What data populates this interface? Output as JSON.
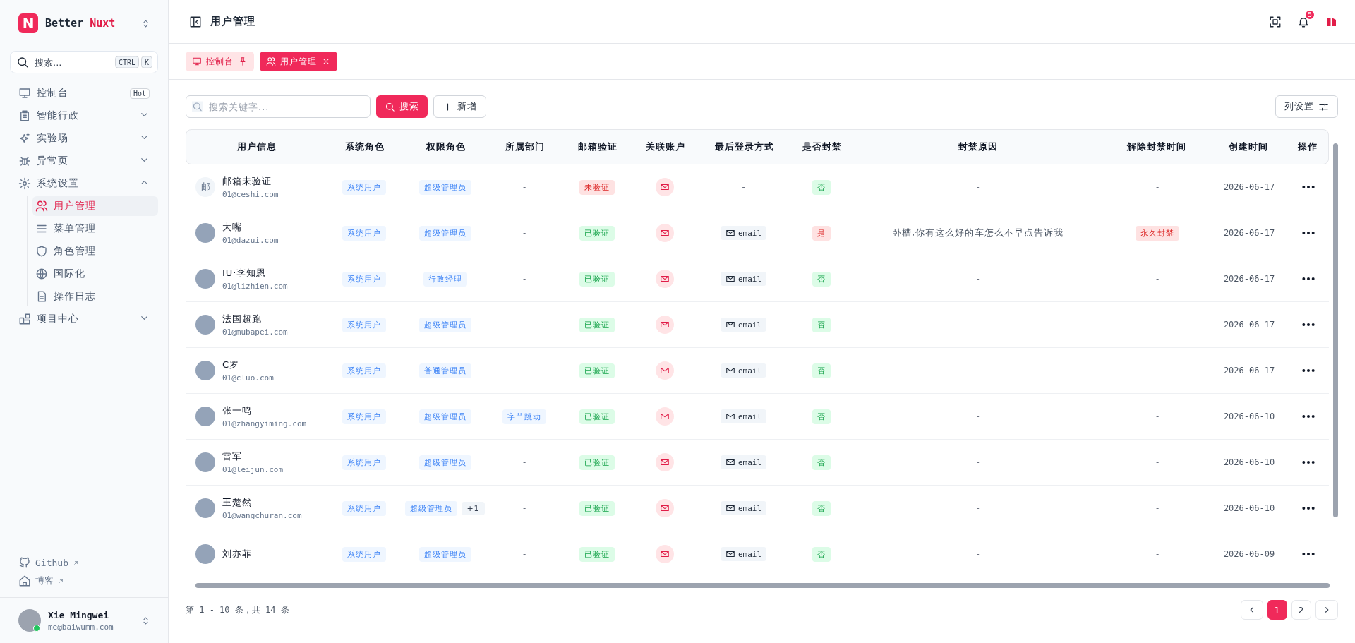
{
  "sidebar": {
    "brand": {
      "name": "Better",
      "accent": "Nuxt",
      "logo": "N"
    },
    "search": {
      "placeholder": "搜索...",
      "keys": [
        "CTRL",
        "K"
      ]
    },
    "menu": [
      {
        "label": "控制台",
        "badge": "Hot",
        "selected": false
      },
      {
        "label": "智能行政",
        "expanded": false,
        "selected": false
      },
      {
        "label": "实验场",
        "expanded": false,
        "selected": false
      },
      {
        "label": "异常页",
        "expanded": false,
        "selected": false
      },
      {
        "label": "系统设置",
        "expanded": true,
        "selected": false,
        "children": [
          {
            "label": "用户管理",
            "selected": true
          },
          {
            "label": "菜单管理",
            "selected": false
          },
          {
            "label": "角色管理",
            "selected": false
          },
          {
            "label": "国际化",
            "selected": false
          },
          {
            "label": "操作日志",
            "selected": false
          }
        ]
      },
      {
        "label": "项目中心",
        "expanded": false,
        "selected": false
      }
    ],
    "links": [
      {
        "label": "Github"
      },
      {
        "label": "博客"
      }
    ],
    "user": {
      "name": "Xie Mingwei",
      "email": "me@baiwumm.com",
      "online": true
    }
  },
  "header": {
    "title": "用户管理",
    "notifications": "5"
  },
  "tabs": [
    {
      "label": "控制台",
      "selected": false,
      "pinned": true
    },
    {
      "label": "用户管理",
      "selected": true,
      "closable": true
    }
  ],
  "toolbar": {
    "search_placeholder": "搜索关键字...",
    "search_button": "搜索",
    "add_button": "新增",
    "columns_button": "列设置"
  },
  "table": {
    "columns": [
      "用户信息",
      "系统角色",
      "权限角色",
      "所属部门",
      "邮箱验证",
      "关联账户",
      "最后登录方式",
      "是否封禁",
      "封禁原因",
      "解除封禁时间",
      "创建时间",
      "操作"
    ],
    "rows": [
      {
        "name": "邮箱未验证",
        "email": "01@ceshi.com",
        "avatar_text": "邮",
        "system_role": "系统用户",
        "roles": [
          "超级管理员"
        ],
        "department": {
          "kind": "none",
          "label": "-"
        },
        "email_verified": false,
        "verify_label": "未验证",
        "last_login": {
          "kind": "none",
          "label": "-"
        },
        "banned": false,
        "ban_label": "否",
        "ban_reason": "-",
        "unban_time": "-",
        "created": "2026-06-17"
      },
      {
        "name": "大嘴",
        "email": "01@dazui.com",
        "system_role": "系统用户",
        "roles": [
          "超级管理员"
        ],
        "department": {
          "kind": "none",
          "label": "-"
        },
        "email_verified": true,
        "verify_label": "已验证",
        "last_login": {
          "kind": "email",
          "label": "email"
        },
        "banned": true,
        "ban_label": "是",
        "ban_reason": "卧槽,你有这么好的车怎么不早点告诉我",
        "unban_time": "永久封禁",
        "created": "2026-06-17"
      },
      {
        "name": "IU·李知恩",
        "email": "01@lizhien.com",
        "system_role": "系统用户",
        "roles": [
          "行政经理"
        ],
        "department": {
          "kind": "none",
          "label": "-"
        },
        "email_verified": true,
        "verify_label": "已验证",
        "last_login": {
          "kind": "email",
          "label": "email"
        },
        "banned": false,
        "ban_label": "否",
        "ban_reason": "-",
        "unban_time": "-",
        "created": "2026-06-17"
      },
      {
        "name": "法国超跑",
        "email": "01@mubapei.com",
        "system_role": "系统用户",
        "roles": [
          "超级管理员"
        ],
        "department": {
          "kind": "none",
          "label": "-"
        },
        "email_verified": true,
        "verify_label": "已验证",
        "last_login": {
          "kind": "email",
          "label": "email"
        },
        "banned": false,
        "ban_label": "否",
        "ban_reason": "-",
        "unban_time": "-",
        "created": "2026-06-17"
      },
      {
        "name": "C罗",
        "email": "01@cluo.com",
        "system_role": "系统用户",
        "roles": [
          "普通管理员"
        ],
        "department": {
          "kind": "none",
          "label": "-"
        },
        "email_verified": true,
        "verify_label": "已验证",
        "last_login": {
          "kind": "email",
          "label": "email"
        },
        "banned": false,
        "ban_label": "否",
        "ban_reason": "-",
        "unban_time": "-",
        "created": "2026-06-17"
      },
      {
        "name": "张一鸣",
        "email": "01@zhangyiming.com",
        "system_role": "系统用户",
        "roles": [
          "超级管理员"
        ],
        "department": {
          "kind": "tag",
          "label": "字节跳动"
        },
        "email_verified": true,
        "verify_label": "已验证",
        "last_login": {
          "kind": "email",
          "label": "email"
        },
        "banned": false,
        "ban_label": "否",
        "ban_reason": "-",
        "unban_time": "-",
        "created": "2026-06-10"
      },
      {
        "name": "雷军",
        "email": "01@leijun.com",
        "system_role": "系统用户",
        "roles": [
          "超级管理员"
        ],
        "department": {
          "kind": "none",
          "label": "-"
        },
        "email_verified": true,
        "verify_label": "已验证",
        "last_login": {
          "kind": "email",
          "label": "email"
        },
        "banned": false,
        "ban_label": "否",
        "ban_reason": "-",
        "unban_time": "-",
        "created": "2026-06-10"
      },
      {
        "name": "王楚然",
        "email": "01@wangchuran.com",
        "system_role": "系统用户",
        "roles": [
          "超级管理员"
        ],
        "extra_roles": "+1",
        "department": {
          "kind": "none",
          "label": "-"
        },
        "email_verified": true,
        "verify_label": "已验证",
        "last_login": {
          "kind": "email",
          "label": "email"
        },
        "banned": false,
        "ban_label": "否",
        "ban_reason": "-",
        "unban_time": "-",
        "created": "2026-06-10"
      },
      {
        "name": "刘亦菲",
        "system_role": "系统用户",
        "roles": [
          "超级管理员"
        ],
        "department": {
          "kind": "none",
          "label": "-"
        },
        "email_verified": true,
        "verify_label": "已验证",
        "last_login": {
          "kind": "email",
          "label": "email"
        },
        "banned": false,
        "ban_label": "否",
        "ban_reason": "-",
        "unban_time": "-",
        "created": "2026-06-09"
      }
    ]
  },
  "footer": {
    "summary": "第 1 - 10 条，共 14 条",
    "pages": [
      {
        "label": "1",
        "selected": true
      },
      {
        "label": "2",
        "selected": false
      }
    ]
  }
}
